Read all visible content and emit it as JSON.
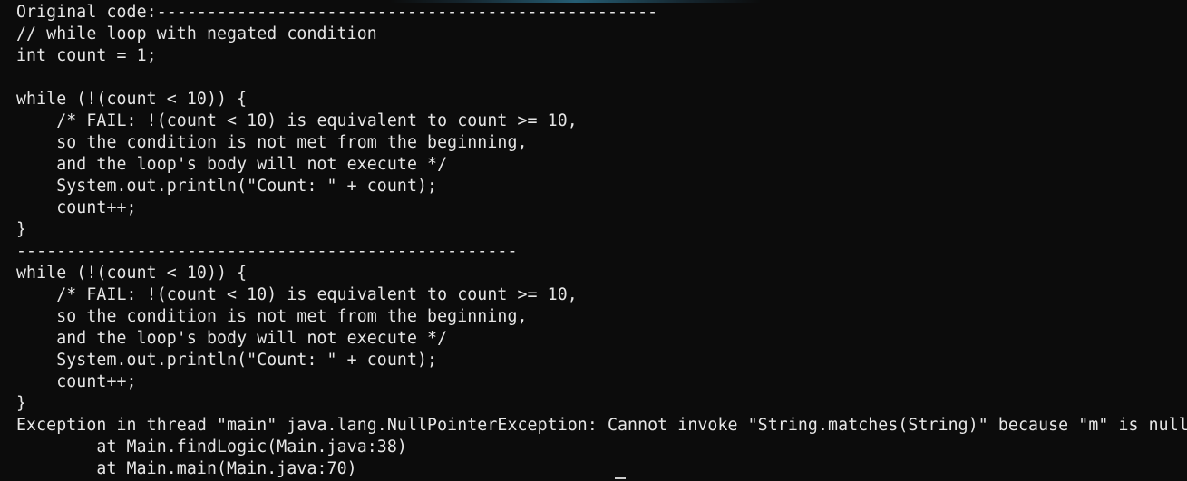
{
  "terminal": {
    "lines": [
      "Original code:--------------------------------------------------",
      "// while loop with negated condition",
      "int count = 1;",
      "",
      "while (!(count < 10)) {",
      "    /* FAIL: !(count < 10) is equivalent to count >= 10,",
      "    so the condition is not met from the beginning,",
      "    and the loop's body will not execute */",
      "    System.out.println(\"Count: \" + count);",
      "    count++;",
      "}",
      "--------------------------------------------------",
      "while (!(count < 10)) {",
      "    /* FAIL: !(count < 10) is equivalent to count >= 10,",
      "    so the condition is not met from the beginning,",
      "    and the loop's body will not execute */",
      "    System.out.println(\"Count: \" + count);",
      "    count++;",
      "}",
      "Exception in thread \"main\" java.lang.NullPointerException: Cannot invoke \"String.matches(String)\" because \"m\" is null",
      "        at Main.findLogic(Main.java:38)",
      "        at Main.main(Main.java:70)"
    ]
  }
}
